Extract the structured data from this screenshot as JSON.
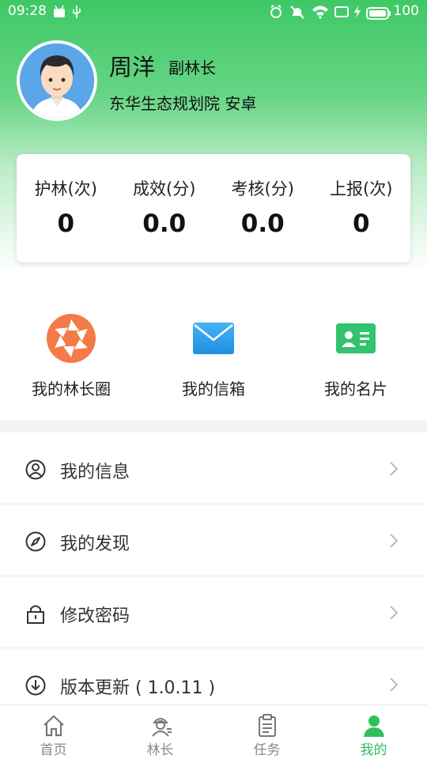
{
  "status_bar": {
    "time": "09:28",
    "battery": "100"
  },
  "profile": {
    "name": "周洋",
    "role": "副林长",
    "org": "东华生态规划院 安卓"
  },
  "stats": [
    {
      "label": "护林(次)",
      "value": "0"
    },
    {
      "label": "成效(分)",
      "value": "0.0"
    },
    {
      "label": "考核(分)",
      "value": "0.0"
    },
    {
      "label": "上报(次)",
      "value": "0"
    }
  ],
  "quick_actions": [
    {
      "label": "我的林长圈",
      "icon": "aperture-icon"
    },
    {
      "label": "我的信箱",
      "icon": "mail-icon"
    },
    {
      "label": "我的名片",
      "icon": "card-icon"
    }
  ],
  "menu": [
    {
      "label": "我的信息",
      "icon": "user-circle-icon"
    },
    {
      "label": "我的发现",
      "icon": "compass-icon"
    },
    {
      "label": "修改密码",
      "icon": "lock-icon"
    },
    {
      "label": "版本更新 ( 1.0.11 )",
      "icon": "download-circle-icon"
    }
  ],
  "bottom_nav": [
    {
      "label": "首页",
      "icon": "home-icon",
      "active": false
    },
    {
      "label": "林长",
      "icon": "ranger-icon",
      "active": false
    },
    {
      "label": "任务",
      "icon": "clipboard-icon",
      "active": false
    },
    {
      "label": "我的",
      "icon": "person-icon",
      "active": true
    }
  ],
  "colors": {
    "accent": "#2fbf5c",
    "header_green": "#3fc866"
  }
}
